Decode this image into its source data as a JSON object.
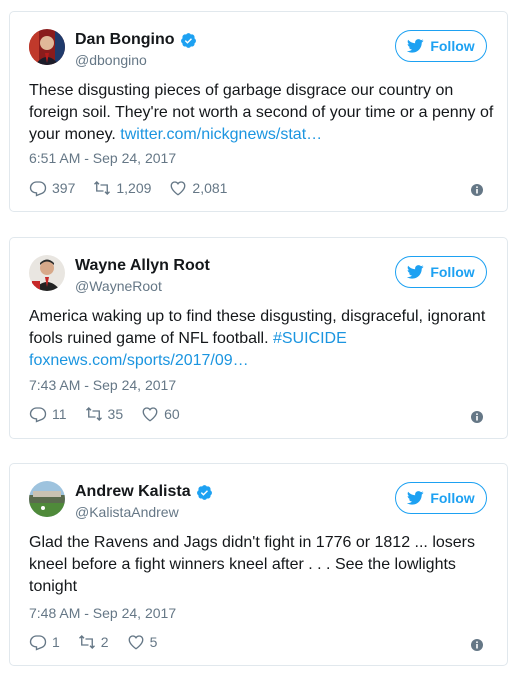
{
  "colors": {
    "accent": "#1da1f2",
    "link": "#1b95e0",
    "muted": "#657786",
    "text": "#14171a",
    "border": "#e1e8ed"
  },
  "follow_label": "Follow",
  "tweets": [
    {
      "name": "Dan Bongino",
      "verified": true,
      "handle": "@dbongino",
      "text": "These disgusting pieces of garbage disgrace our country on foreign soil. They're not worth a second of your time or a penny of your money. ",
      "link": "twitter.com/nickgnews/stat…",
      "time": "6:51 AM - Sep 24, 2017",
      "replies": "397",
      "retweets": "1,209",
      "likes": "2,081"
    },
    {
      "name": "Wayne Allyn Root",
      "verified": false,
      "handle": "@WayneRoot",
      "text": "America waking up to find these disgusting, disgraceful, ignorant fools ruined game of NFL football. ",
      "hashtag": "#SUICIDE",
      "link": "foxnews.com/sports/2017/09…",
      "time": "7:43 AM - Sep 24, 2017",
      "replies": "11",
      "retweets": "35",
      "likes": "60"
    },
    {
      "name": "Andrew Kalista",
      "verified": true,
      "handle": "@KalistaAndrew",
      "text": "Glad the Ravens and Jags didn't fight in 1776 or 1812 ... losers kneel before a fight winners kneel after . . . See the lowlights tonight",
      "time": "7:48 AM - Sep 24, 2017",
      "replies": "1",
      "retweets": "2",
      "likes": "5"
    }
  ]
}
